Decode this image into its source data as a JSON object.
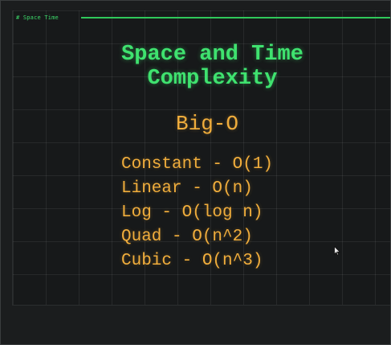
{
  "tab": {
    "label": "# Space Time"
  },
  "slide": {
    "title_line1": "Space and Time",
    "title_line2": "Complexity",
    "subtitle": "Big-O",
    "items": [
      "Constant - O(1)",
      "Linear - O(n)",
      "Log - O(log n)",
      "Quad - O(n^2)",
      "Cubic - O(n^3)"
    ]
  },
  "colors": {
    "title": "#3fe26f",
    "body": "#f0ad3c",
    "background": "#17191a",
    "header_rule": "#2fc85a"
  },
  "icons": {
    "cursor": "mouse-pointer-icon"
  }
}
